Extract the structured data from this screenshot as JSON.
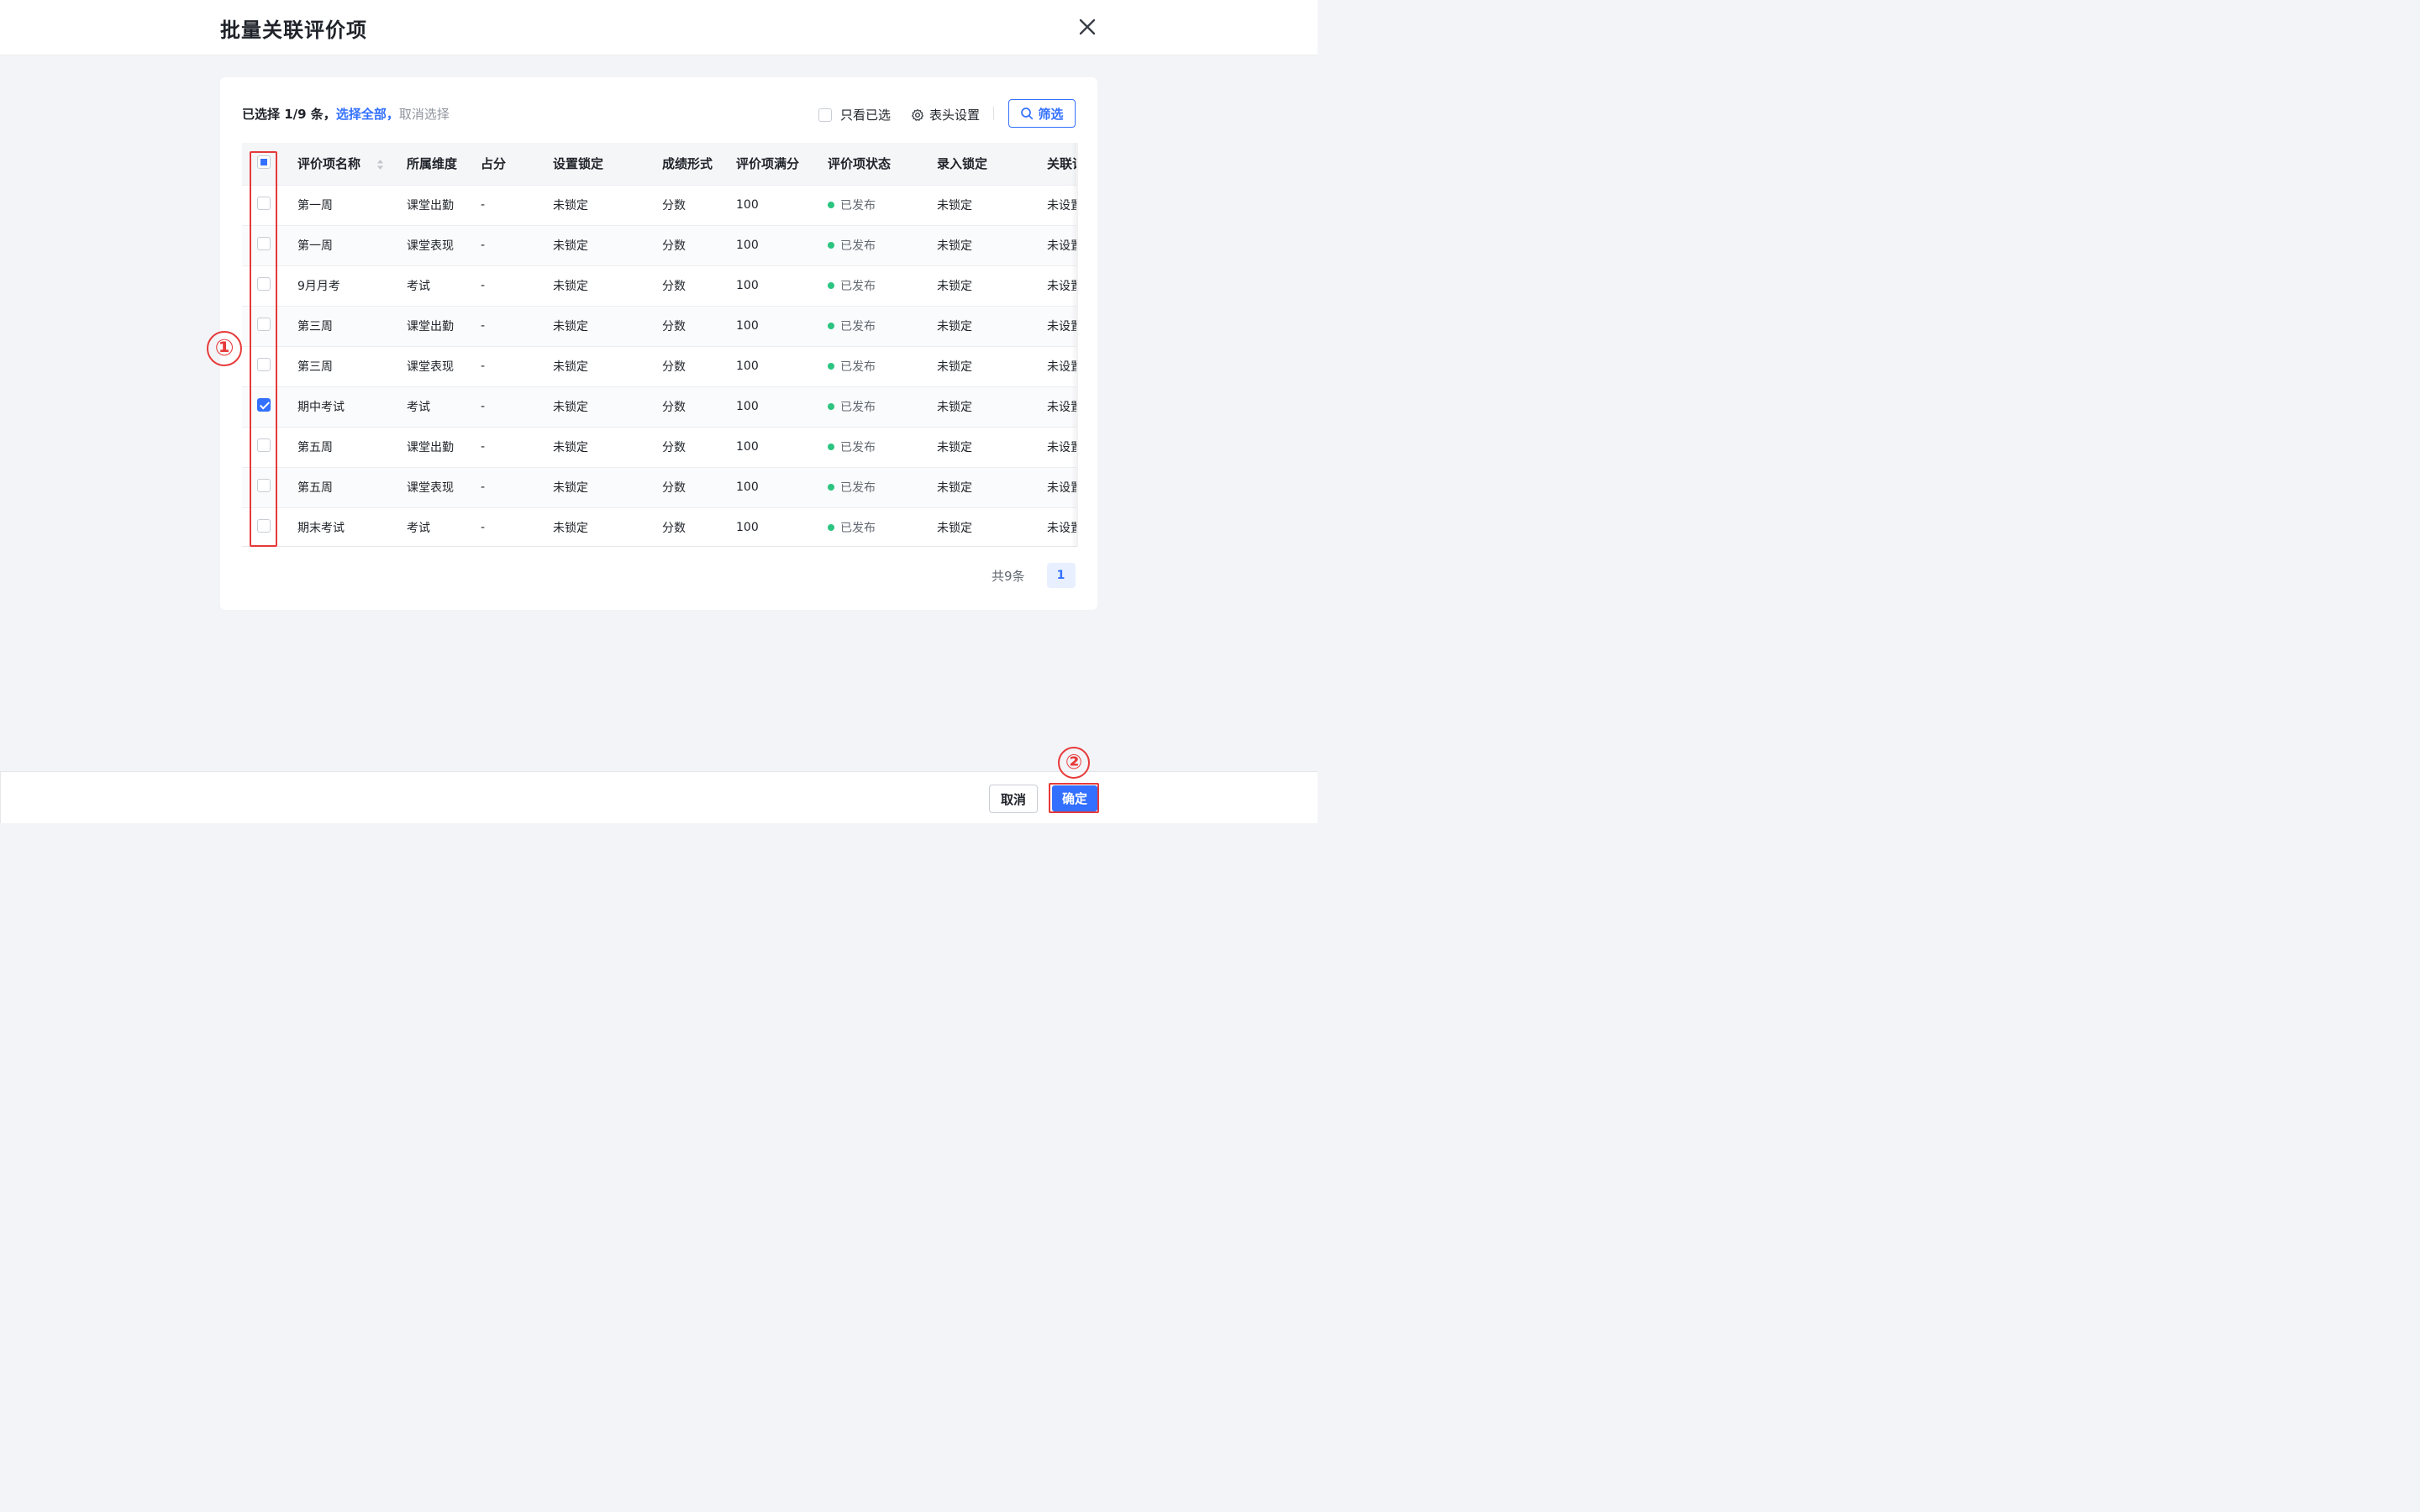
{
  "dialog": {
    "title": "批量关联评价项"
  },
  "toolbar": {
    "selected_text": "已选择 1/9 条，",
    "select_all": "选择全部，",
    "cancel_selection": "取消选择",
    "only_selected": "只看已选",
    "column_settings": "表头设置",
    "filter": "筛选"
  },
  "table": {
    "headers": [
      "评价项名称",
      "所属维度",
      "占分",
      "设置锁定",
      "成绩形式",
      "评价项满分",
      "评价项状态",
      "录入锁定",
      "关联证"
    ],
    "rows": [
      {
        "checked": false,
        "cells": [
          "第一周",
          "课堂出勤",
          "-",
          "未锁定",
          "分数",
          "100",
          "已发布",
          "未锁定",
          "未设置"
        ]
      },
      {
        "checked": false,
        "cells": [
          "第一周",
          "课堂表现",
          "-",
          "未锁定",
          "分数",
          "100",
          "已发布",
          "未锁定",
          "未设置"
        ]
      },
      {
        "checked": false,
        "cells": [
          "9月月考",
          "考试",
          "-",
          "未锁定",
          "分数",
          "100",
          "已发布",
          "未锁定",
          "未设置"
        ]
      },
      {
        "checked": false,
        "cells": [
          "第三周",
          "课堂出勤",
          "-",
          "未锁定",
          "分数",
          "100",
          "已发布",
          "未锁定",
          "未设置"
        ]
      },
      {
        "checked": false,
        "cells": [
          "第三周",
          "课堂表现",
          "-",
          "未锁定",
          "分数",
          "100",
          "已发布",
          "未锁定",
          "未设置"
        ]
      },
      {
        "checked": true,
        "cells": [
          "期中考试",
          "考试",
          "-",
          "未锁定",
          "分数",
          "100",
          "已发布",
          "未锁定",
          "未设置"
        ]
      },
      {
        "checked": false,
        "cells": [
          "第五周",
          "课堂出勤",
          "-",
          "未锁定",
          "分数",
          "100",
          "已发布",
          "未锁定",
          "未设置"
        ]
      },
      {
        "checked": false,
        "cells": [
          "第五周",
          "课堂表现",
          "-",
          "未锁定",
          "分数",
          "100",
          "已发布",
          "未锁定",
          "未设置"
        ]
      },
      {
        "checked": false,
        "cells": [
          "期末考试",
          "考试",
          "-",
          "未锁定",
          "分数",
          "100",
          "已发布",
          "未锁定",
          "未设置"
        ]
      }
    ]
  },
  "pagination": {
    "total": "共9条",
    "current_page": "1"
  },
  "footer": {
    "cancel": "取消",
    "confirm": "确定"
  },
  "annotations": {
    "marker_1": "①",
    "marker_2": "②"
  },
  "colors": {
    "primary": "#3370ff",
    "published_dot": "#2bc480",
    "annotation_red": "#e63a3a"
  }
}
